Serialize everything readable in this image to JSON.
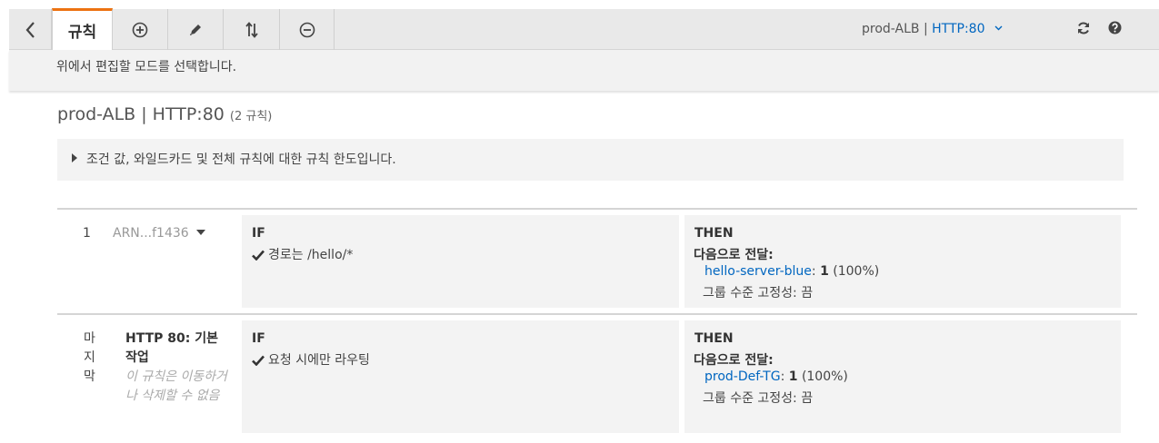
{
  "toolbar": {
    "back_icon": "chevron-left-icon",
    "active_tab": "규칙",
    "add_icon": "plus-circle-icon",
    "edit_icon": "pencil-icon",
    "reorder_icon": "sort-arrows-icon",
    "remove_icon": "minus-circle-icon",
    "load_balancer": "prod-ALB",
    "separator": "|",
    "listener": "HTTP:80",
    "refresh_icon": "refresh-icon",
    "help_icon": "help-icon"
  },
  "info": {
    "text": "위에서 편집할 모드를 선택합니다."
  },
  "header": {
    "title": "prod-ALB | HTTP:80",
    "rule_count": "(2 규칙)"
  },
  "limits": {
    "text": "조건 값, 와일드카드 및 전체 규칙에 대한 규칙 한도입니다."
  },
  "rules": [
    {
      "number": "1",
      "arn": "ARN...f1436",
      "if_label": "IF",
      "condition": "경로는 /hello/*",
      "then_label": "THEN",
      "forward_label": "다음으로 전달:",
      "target_group": "hello-server-blue",
      "colon": ":",
      "weight": "1",
      "percent": "(100%)",
      "stickiness": "그룹 수준 고정성: 끔"
    },
    {
      "number": "마지막",
      "name": "HTTP 80: 기본 작업",
      "note": "이 규칙은 이동하거나 삭제할 수 없음",
      "if_label": "IF",
      "condition": "요청 시에만 라우팅",
      "then_label": "THEN",
      "forward_label": "다음으로 전달:",
      "target_group": "prod-Def-TG",
      "colon": ":",
      "weight": "1",
      "percent": "(100%)",
      "stickiness": "그룹 수준 고정성: 끔"
    }
  ],
  "colors": {
    "accent": "#ec7211",
    "link": "#0066c0",
    "panel": "#f3f3f3",
    "toolbar": "#e9e9e9"
  }
}
